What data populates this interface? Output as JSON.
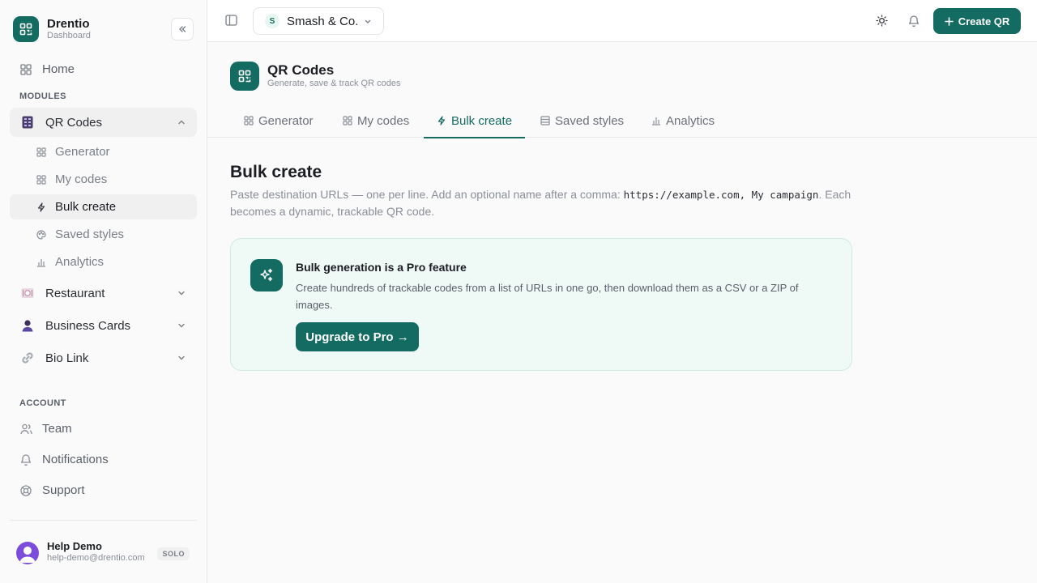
{
  "brand": {
    "name": "Drentio",
    "subtitle": "Dashboard"
  },
  "sidebar": {
    "home": "Home",
    "modules_label": "MODULES",
    "qr_codes": {
      "label": "QR Codes",
      "items": [
        {
          "label": "Generator",
          "icon": "grid-icon"
        },
        {
          "label": "My codes",
          "icon": "grid-icon"
        },
        {
          "label": "Bulk create",
          "icon": "bolt-icon"
        },
        {
          "label": "Saved styles",
          "icon": "palette-icon"
        },
        {
          "label": "Analytics",
          "icon": "bar-chart-icon"
        }
      ]
    },
    "modules": [
      {
        "label": "Restaurant",
        "icon": "plate-icon"
      },
      {
        "label": "Business Cards",
        "icon": "person-icon"
      },
      {
        "label": "Bio Link",
        "icon": "link-icon"
      }
    ],
    "account_label": "ACCOUNT",
    "account": [
      {
        "label": "Team",
        "icon": "users-icon"
      },
      {
        "label": "Notifications",
        "icon": "bell-icon"
      },
      {
        "label": "Support",
        "icon": "lifebuoy-icon"
      }
    ],
    "user": {
      "name": "Help Demo",
      "email": "help-demo@drentio.com",
      "plan": "SOLO"
    }
  },
  "topbar": {
    "workspace_initial": "S",
    "workspace_name": "Smash & Co.",
    "create_label": "Create QR"
  },
  "page": {
    "title": "QR Codes",
    "subtitle": "Generate, save & track QR codes"
  },
  "tabs": [
    {
      "label": "Generator"
    },
    {
      "label": "My codes"
    },
    {
      "label": "Bulk create"
    },
    {
      "label": "Saved styles"
    },
    {
      "label": "Analytics"
    }
  ],
  "content": {
    "title": "Bulk create",
    "desc_prefix": "Paste destination URLs — one per line. Add an optional name after a comma: ",
    "desc_code": "https://example.com, My campaign",
    "desc_suffix": ". Each becomes a dynamic, trackable QR code.",
    "pro_title": "Bulk generation is a Pro feature",
    "pro_desc": "Create hundreds of trackable codes from a list of URLs in one go, then download them as a CSV or a ZIP of images.",
    "upgrade_label": "Upgrade to Pro →"
  },
  "colors": {
    "accent": "#146b61",
    "pro_bg": "#effaf7",
    "pro_border": "#cfe9e3"
  }
}
